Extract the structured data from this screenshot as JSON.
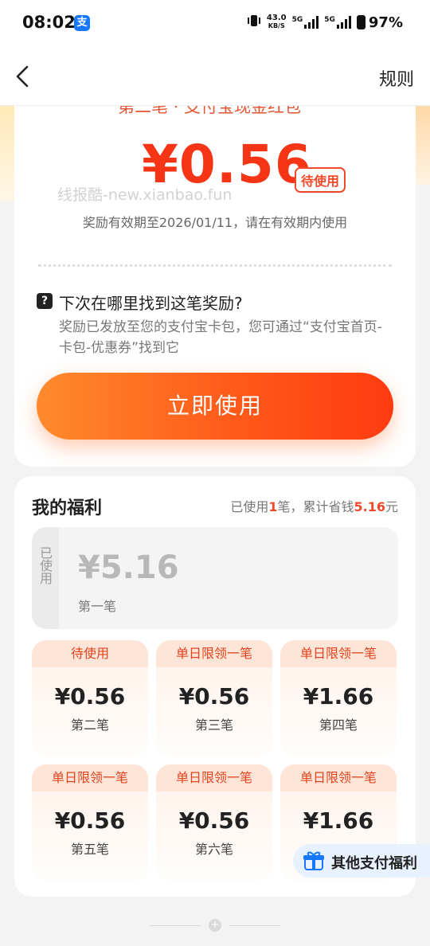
{
  "status_bar": {
    "time": "08:02",
    "alipay_badge": "支",
    "net_speed_value": "43.0",
    "net_speed_unit": "KB/S",
    "network_1": "5G",
    "network_2": "5G",
    "battery": "97%"
  },
  "header": {
    "rules_label": "规则"
  },
  "reward": {
    "subtitle": "第二笔 · 支付宝现金红包",
    "amount": "¥0.56",
    "status": "待使用",
    "watermark": "线报酷-new.xianbao.fun",
    "validity": "奖励有效期至2026/01/11，请在有效期内使用",
    "faq_icon": "?",
    "faq_title": "下次在哪里找到这笔奖励?",
    "faq_desc": "奖励已发放至您的支付宝卡包，您可通过“支付宝首页-卡包-优惠券”找到它",
    "use_button": "立即使用"
  },
  "benefits": {
    "title": "我的福利",
    "summary_prefix": "已使用",
    "used_count": "1",
    "summary_mid": "笔，累计省钱",
    "saved_amount": "5.16",
    "summary_suffix": "元",
    "used_card": {
      "tag": "已使用",
      "amount": "¥5.16",
      "label": "第一笔"
    },
    "tiles": [
      {
        "status": "待使用",
        "amount": "¥0.56",
        "name": "第二笔"
      },
      {
        "status": "单日限领一笔",
        "amount": "¥0.56",
        "name": "第三笔"
      },
      {
        "status": "单日限领一笔",
        "amount": "¥1.66",
        "name": "第四笔"
      },
      {
        "status": "单日限领一笔",
        "amount": "¥0.56",
        "name": "第五笔"
      },
      {
        "status": "单日限领一笔",
        "amount": "¥0.56",
        "name": "第六笔"
      },
      {
        "status": "单日限领一笔",
        "amount": "¥1.66",
        "name": ""
      }
    ]
  },
  "floating": {
    "other_benefits": "其他支付福利"
  },
  "footer": {
    "end_icon": "+"
  },
  "colors": {
    "accent": "#f63517",
    "button_start": "#ff8a2d",
    "button_end": "#ff3b10",
    "tag_text": "#e2431e"
  }
}
